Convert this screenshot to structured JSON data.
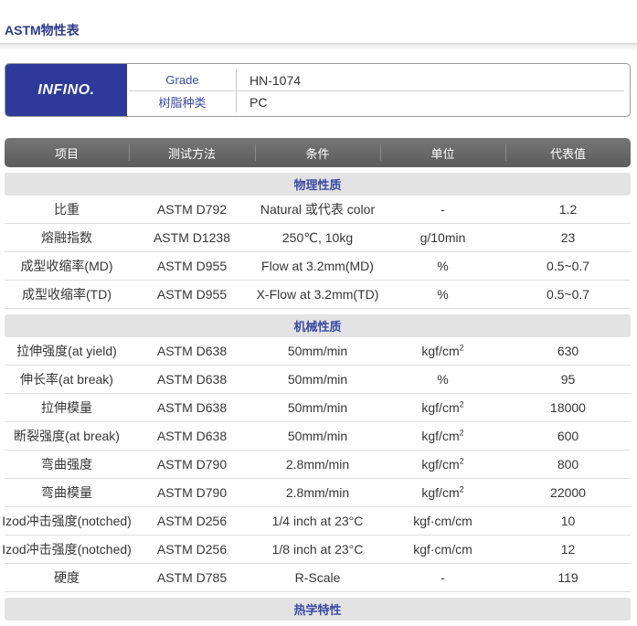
{
  "page": {
    "title": "ASTM物性表"
  },
  "product": {
    "logo": "INFINO.",
    "grade": {
      "label": "Grade",
      "value": "HN-1074"
    },
    "resin_type": {
      "label": "树脂种类",
      "value": "PC"
    }
  },
  "table": {
    "columns": {
      "item": "项目",
      "method": "测试方法",
      "condition": "条件",
      "unit": "单位",
      "value": "代表值"
    },
    "sections": [
      {
        "title": "物理性质",
        "rows": [
          {
            "item": "比重",
            "method": "ASTM D792",
            "condition": "Natural 或代表 color",
            "unit": "-",
            "value": "1.2"
          },
          {
            "item": "熔融指数",
            "method": "ASTM D1238",
            "condition": "250℃, 10kg",
            "unit": "g/10min",
            "value": "23"
          },
          {
            "item": "成型收缩率(MD)",
            "method": "ASTM D955",
            "condition": "Flow at 3.2mm(MD)",
            "unit": "%",
            "value": "0.5~0.7"
          },
          {
            "item": "成型收缩率(TD)",
            "method": "ASTM D955",
            "condition": "X-Flow at 3.2mm(TD)",
            "unit": "%",
            "value": "0.5~0.7"
          }
        ]
      },
      {
        "title": "机械性质",
        "rows": [
          {
            "item": "拉伸强度(at yield)",
            "method": "ASTM D638",
            "condition": "50mm/min",
            "unit": "kgf/cm",
            "unit_sup": "2",
            "value": "630"
          },
          {
            "item": "伸长率(at break)",
            "method": "ASTM D638",
            "condition": "50mm/min",
            "unit": "%",
            "value": "95"
          },
          {
            "item": "拉伸模量",
            "method": "ASTM D638",
            "condition": "50mm/min",
            "unit": "kgf/cm",
            "unit_sup": "2",
            "value": "18000"
          },
          {
            "item": "断裂强度(at break)",
            "method": "ASTM D638",
            "condition": "50mm/min",
            "unit": "kgf/cm",
            "unit_sup": "2",
            "value": "600"
          },
          {
            "item": "弯曲强度",
            "method": "ASTM D790",
            "condition": "2.8mm/min",
            "unit": "kgf/cm",
            "unit_sup": "2",
            "value": "800"
          },
          {
            "item": "弯曲模量",
            "method": "ASTM D790",
            "condition": "2.8mm/min",
            "unit": "kgf/cm",
            "unit_sup": "2",
            "value": "22000"
          },
          {
            "item": "Izod冲击强度(notched)",
            "method": "ASTM D256",
            "condition": "1/4 inch at 23°C",
            "unit": "kgf·cm/cm",
            "value": "10"
          },
          {
            "item": "Izod冲击强度(notched)",
            "method": "ASTM D256",
            "condition": "1/8 inch at 23°C",
            "unit": "kgf·cm/cm",
            "value": "12"
          },
          {
            "item": "硬度",
            "method": "ASTM D785",
            "condition": "R-Scale",
            "unit": "-",
            "value": "119"
          }
        ]
      },
      {
        "title": "热学特性",
        "rows": []
      }
    ]
  },
  "colors": {
    "title_text": "#2b3a8c",
    "brand_panel": "#2e3a99",
    "accent_text": "#3a4aa5",
    "table_header": "#666666",
    "section_band": "#e3e3e3"
  }
}
